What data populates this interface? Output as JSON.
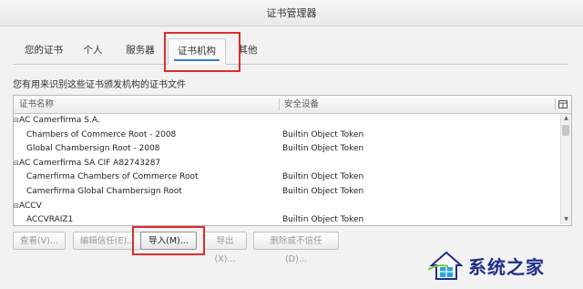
{
  "window": {
    "title": "证书管理器"
  },
  "tabs": [
    {
      "label": "您的证书"
    },
    {
      "label": "个人"
    },
    {
      "label": "服务器"
    },
    {
      "label": "证书机构",
      "active": true
    },
    {
      "label": "其他"
    }
  ],
  "description": "您有用来识别这些证书颁发机构的证书文件",
  "table": {
    "columns": [
      "证书名称",
      "安全设备"
    ],
    "rows": [
      {
        "type": "group",
        "name": "AC Camerfirma S.A.",
        "device": ""
      },
      {
        "type": "item",
        "name": "Chambers of Commerce Root - 2008",
        "device": "Builtin Object Token"
      },
      {
        "type": "item",
        "name": "Global Chambersign Root - 2008",
        "device": "Builtin Object Token"
      },
      {
        "type": "group",
        "name": "AC Camerfirma SA CIF A82743287",
        "device": ""
      },
      {
        "type": "item",
        "name": "Camerfirma Chambers of Commerce Root",
        "device": "Builtin Object Token"
      },
      {
        "type": "item",
        "name": "Camerfirma Global Chambersign Root",
        "device": "Builtin Object Token"
      },
      {
        "type": "group",
        "name": "ACCV",
        "device": ""
      },
      {
        "type": "item",
        "name": "ACCVRAIZ1",
        "device": "Builtin Object Token"
      }
    ]
  },
  "buttons": {
    "view": "查看(V)...",
    "edit_trust": "编辑信任(E)...",
    "import": "导入(M)...",
    "export": "导出(X)...",
    "delete": "删除或不信任(D)..."
  },
  "watermark": {
    "text": "系统之家"
  },
  "colors": {
    "highlight_box": "#e02b2b",
    "tab_underline": "#3a7bd5",
    "watermark": "#1f2f8a"
  }
}
